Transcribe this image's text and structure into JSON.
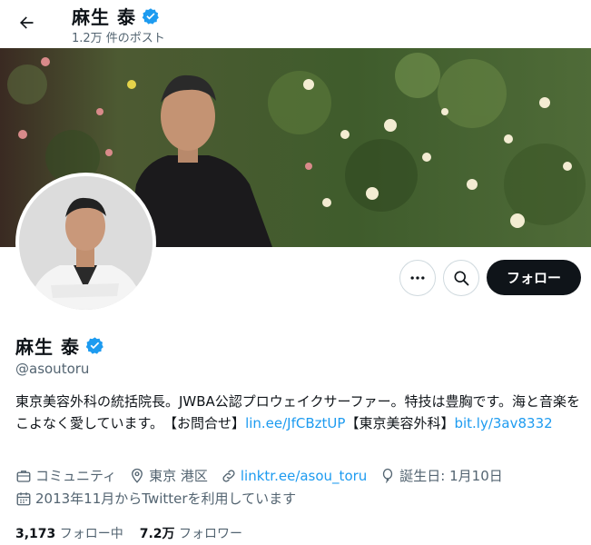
{
  "header": {
    "name": "麻生 泰",
    "post_count": "1.2万 件のポスト"
  },
  "profile": {
    "name": "麻生 泰",
    "handle": "@asoutoru",
    "bio_text_1": "東京美容外科の統括院長。JWBA公認プロウェイクサーファー。特技は豊胸です。海と音楽をこよなく愛しています。　【お問合せ】",
    "bio_link_1": "lin.ee/JfCBztUP",
    "bio_text_2": "【東京美容外科】",
    "bio_link_2": "bit.ly/3av8332",
    "category": "コミュニティ",
    "location": "東京 港区",
    "website": "linktr.ee/asou_toru",
    "birthday": "誕生日: 1月10日",
    "joined": "2013年11月からTwitterを利用しています",
    "following_count": "3,173",
    "following_label": "フォロー中",
    "followers_count": "7.2万",
    "followers_label": "フォロワー"
  },
  "actions": {
    "follow_label": "フォロー"
  },
  "colors": {
    "accent": "#1d9bf0",
    "text": "#0f1419",
    "secondary": "#536471",
    "verified": "#1d9bf0"
  },
  "icons": [
    "back-arrow-icon",
    "verified-badge-icon",
    "more-icon",
    "search-icon",
    "briefcase-icon",
    "location-icon",
    "link-icon",
    "balloon-icon",
    "calendar-icon"
  ]
}
